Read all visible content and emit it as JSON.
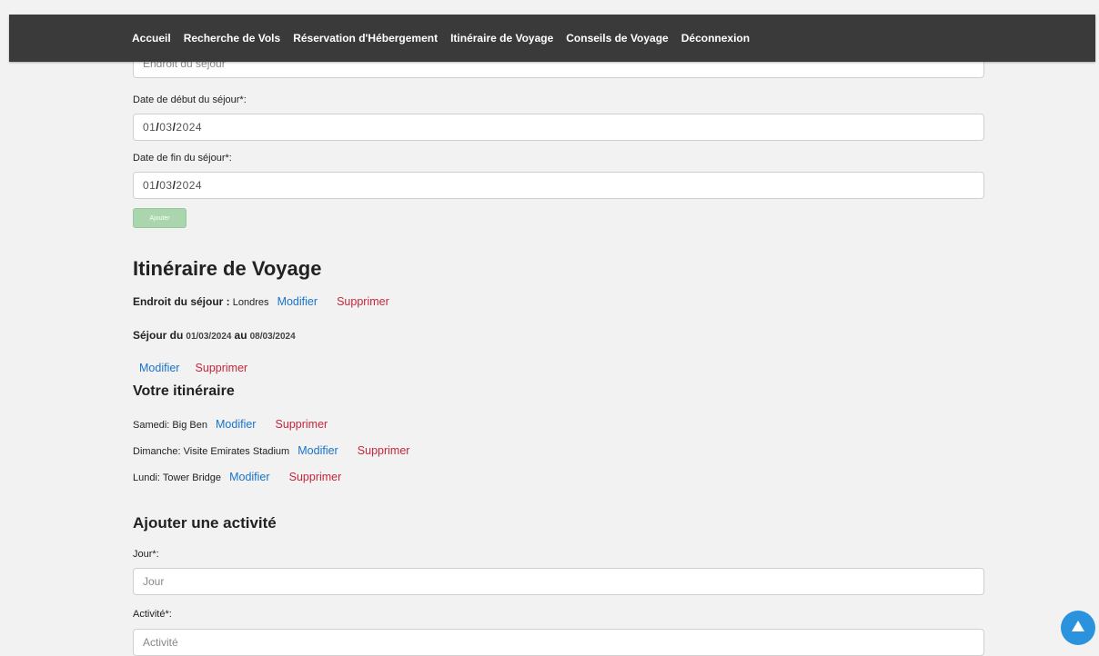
{
  "nav": {
    "items": [
      "Accueil",
      "Recherche de Vols",
      "Réservation d'Hébergement",
      "Itinéraire de Voyage",
      "Conseils de Voyage",
      "Déconnexion"
    ]
  },
  "stay_form": {
    "place_placeholder": "Endroit du séjour",
    "start_label": "Date de début du séjour*:",
    "start_value": {
      "day": "01",
      "month": "03",
      "year": "2024"
    },
    "end_label": "Date de fin du séjour*:",
    "end_value": {
      "day": "01",
      "month": "03",
      "year": "2024"
    },
    "add_button": "Ajouter"
  },
  "itinerary": {
    "title": "Itinéraire de Voyage",
    "place_label": "Endroit du séjour :",
    "place_value": "Londres",
    "modify": "Modifier",
    "delete": "Supprimer",
    "stay_prefix": "Séjour du",
    "stay_start": "01/03/2024",
    "stay_mid": "au",
    "stay_end": "08/03/2024",
    "your_itinerary": "Votre itinéraire",
    "activities": [
      "Samedi: Big Ben",
      "Dimanche: Visite Emirates Stadium",
      "Lundi: Tower Bridge"
    ]
  },
  "add_activity": {
    "title": "Ajouter une activité",
    "day_label": "Jour*:",
    "day_placeholder": "Jour",
    "activity_label": "Activité*:",
    "activity_placeholder": "Activité"
  },
  "icons": {
    "scroll_top": "arrow-up-icon"
  },
  "colors": {
    "nav_bg": "#3a3a3a",
    "link_blue": "#1a73c9",
    "link_red": "#c4263c",
    "btn_green": "#a9d6ad",
    "fab": "#2b93de"
  }
}
